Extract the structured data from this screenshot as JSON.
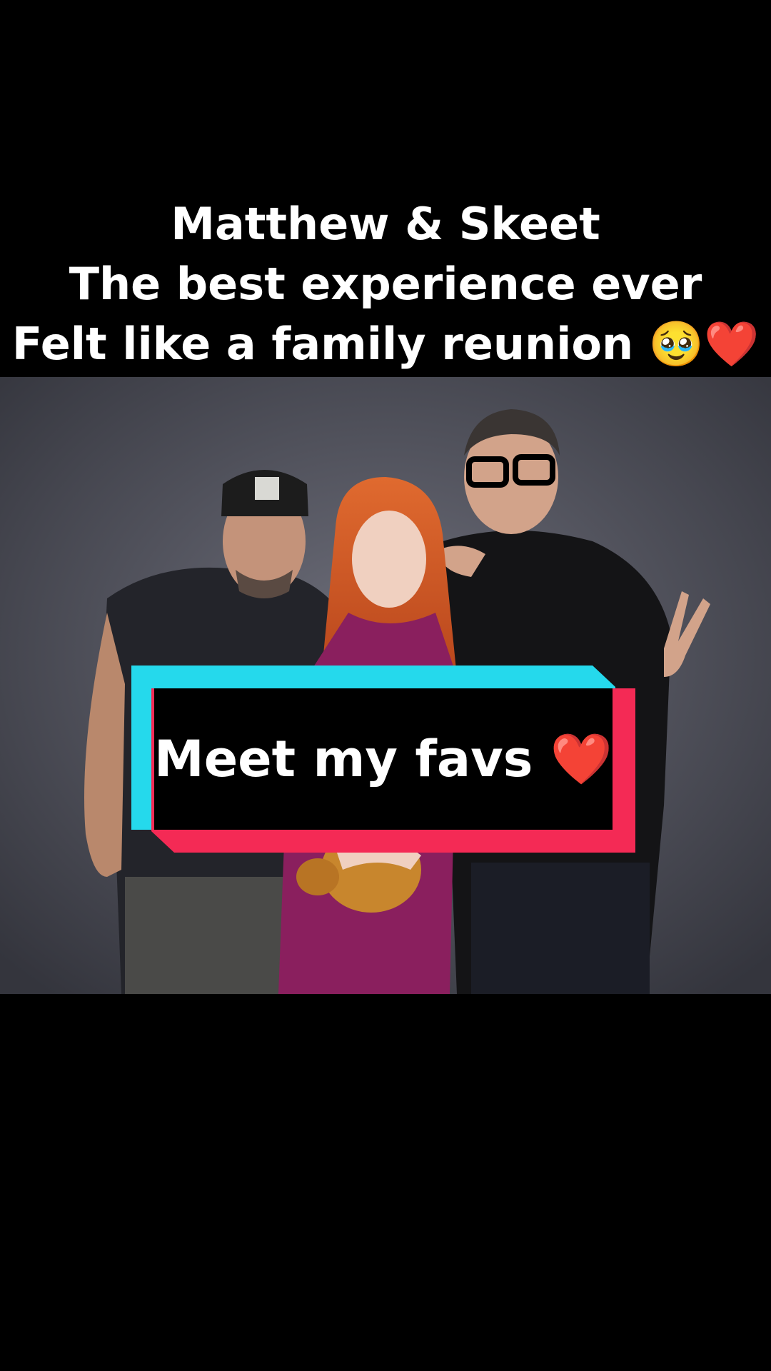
{
  "caption": {
    "line1": "Matthew & Skeet",
    "line2": "The best experience ever",
    "line3": "Felt like a family reunion 🥹❤️"
  },
  "sticker": {
    "text": "Meet my favs ❤️",
    "colors": {
      "cyan": "#25d9ec",
      "red": "#f42a55",
      "inner": "#000000"
    }
  },
  "photo": {
    "description_hidden": ""
  }
}
